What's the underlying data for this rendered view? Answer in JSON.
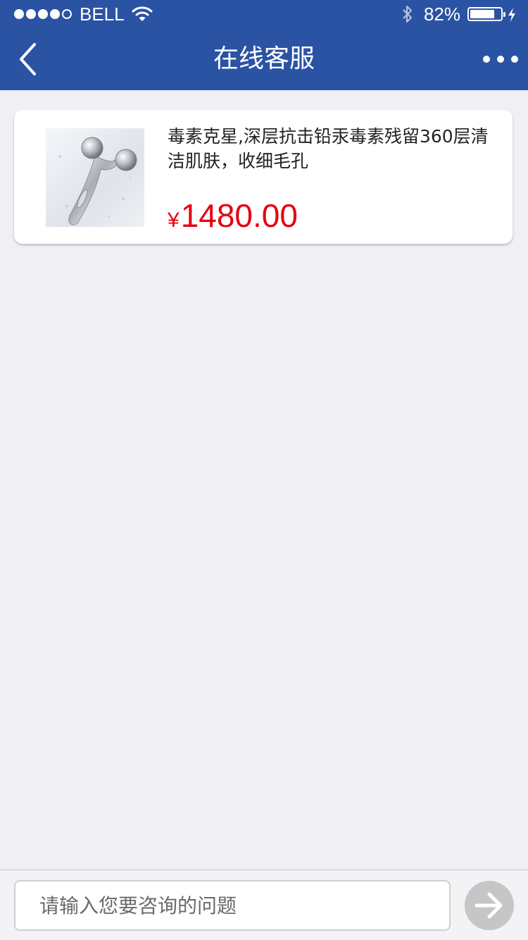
{
  "status_bar": {
    "carrier": "BELL",
    "battery_percent": "82%",
    "battery_level": 0.82,
    "signal_bars_filled": 4,
    "signal_bars_total": 5
  },
  "nav": {
    "title": "在线客服",
    "back_icon": "chevron-left-icon",
    "more_icon": "more-dots-icon"
  },
  "product": {
    "title": "毒素克星,深层抗击铅汞毒素残留360层清洁肌肤，收细毛孔",
    "currency": "¥",
    "price": "1480.00",
    "price_color": "#e60012",
    "image": "face-roller-image"
  },
  "input": {
    "placeholder": "请输入您要咨询的问题",
    "value": ""
  },
  "send": {
    "icon": "arrow-right-icon"
  },
  "colors": {
    "header": "#2b53a3",
    "background": "#efeff4"
  }
}
